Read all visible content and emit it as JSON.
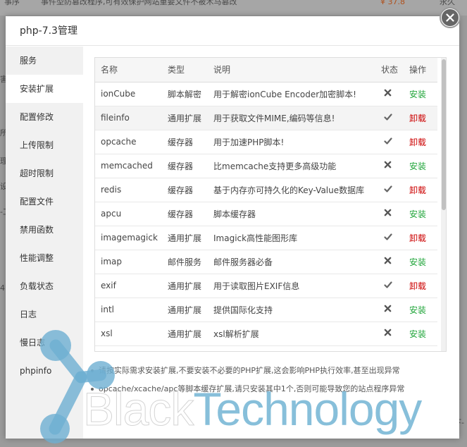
{
  "background": {
    "top_row": [
      "事序",
      "事件型防篡改程序,可有效保护网站重要文件不被木马篡改",
      "¥ 37.8",
      "永久"
    ],
    "edge_labels": [
      "害",
      "所",
      "理",
      "设",
      "型",
      "-工",
      "4",
      "统"
    ],
    "right_label": "下-"
  },
  "modal": {
    "title": "php-7.3管理",
    "sidebar": [
      "服务",
      "安装扩展",
      "配置修改",
      "上传限制",
      "超时限制",
      "配置文件",
      "禁用函数",
      "性能调整",
      "负载状态",
      "日志",
      "慢日志",
      "phpinfo"
    ],
    "active_sidebar_index": 1,
    "table": {
      "headers": [
        "名称",
        "类型",
        "说明",
        "状态",
        "操作"
      ],
      "rows": [
        {
          "name": "ionCube",
          "type": "脚本解密",
          "desc": "用于解密ionCube Encoder加密脚本!",
          "installed": false,
          "op": "安装"
        },
        {
          "name": "fileinfo",
          "type": "通用扩展",
          "desc": "用于获取文件MIME,编码等信息!",
          "installed": true,
          "op": "卸载"
        },
        {
          "name": "opcache",
          "type": "缓存器",
          "desc": "用于加速PHP脚本!",
          "installed": true,
          "op": "卸载"
        },
        {
          "name": "memcached",
          "type": "缓存器",
          "desc": "比memcache支持更多高级功能",
          "installed": false,
          "op": "安装"
        },
        {
          "name": "redis",
          "type": "缓存器",
          "desc": "基于内存亦可持久化的Key-Value数据库",
          "installed": true,
          "op": "卸载"
        },
        {
          "name": "apcu",
          "type": "缓存器",
          "desc": "脚本缓存器",
          "installed": false,
          "op": "安装"
        },
        {
          "name": "imagemagick",
          "type": "通用扩展",
          "desc": "Imagick高性能图形库",
          "installed": true,
          "op": "卸载"
        },
        {
          "name": "imap",
          "type": "邮件服务",
          "desc": "邮件服务器必备",
          "installed": false,
          "op": "安装"
        },
        {
          "name": "exif",
          "type": "通用扩展",
          "desc": "用于读取图片EXIF信息",
          "installed": true,
          "op": "卸载"
        },
        {
          "name": "intl",
          "type": "通用扩展",
          "desc": "提供国际化支持",
          "installed": false,
          "op": "安装"
        },
        {
          "name": "xsl",
          "type": "通用扩展",
          "desc": "xsl解析扩展",
          "installed": false,
          "op": "安装"
        }
      ]
    },
    "notes": [
      "请按实际需求安装扩展,不要安装不必要的PHP扩展,这会影响PHP执行效率,甚至出现异常",
      "opcache/xcache/apc等脚本缓存扩展,请只安装其中1个,否则可能导致您的站点程序异常"
    ]
  },
  "watermark": {
    "part1": "Black",
    "part2": "Technology"
  },
  "colors": {
    "install": "#20a53a",
    "uninstall": "#cc0000",
    "accent_blue": "#6fb3d6"
  }
}
